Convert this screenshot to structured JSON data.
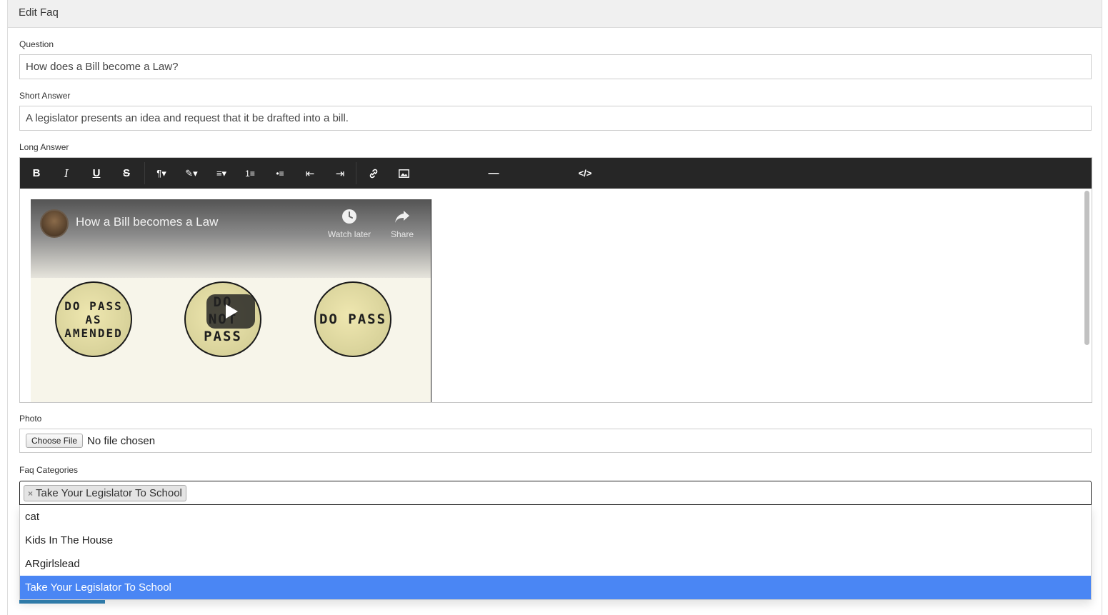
{
  "panel": {
    "title": "Edit Faq"
  },
  "question": {
    "label": "Question",
    "value": "How does a Bill become a Law?"
  },
  "short_answer": {
    "label": "Short Answer",
    "value": "A legislator presents an idea and request that it be drafted into a bill."
  },
  "long_answer": {
    "label": "Long Answer",
    "toolbar": [
      {
        "icon": "bold-icon",
        "glyph": "B"
      },
      {
        "icon": "italic-icon",
        "glyph": "I"
      },
      {
        "icon": "underline-icon",
        "glyph": "U"
      },
      {
        "icon": "strikethrough-icon",
        "glyph": "S"
      },
      {
        "icon": "paragraph-style-icon",
        "glyph": "¶▾"
      },
      {
        "icon": "magic-style-icon",
        "glyph": "✎▾"
      },
      {
        "icon": "align-icon",
        "glyph": "≡▾"
      },
      {
        "icon": "ordered-list-icon",
        "glyph": "1≡"
      },
      {
        "icon": "unordered-list-icon",
        "glyph": "•≡"
      },
      {
        "icon": "outdent-icon",
        "glyph": "⇤"
      },
      {
        "icon": "indent-icon",
        "glyph": "⇥"
      },
      {
        "icon": "link-icon",
        "glyph": "🔗"
      },
      {
        "icon": "image-icon",
        "glyph": "▣"
      },
      {
        "icon": "horizontal-rule-icon",
        "glyph": "—"
      },
      {
        "icon": "code-view-icon",
        "glyph": "</>"
      }
    ],
    "video": {
      "title": "How a Bill becomes a Law",
      "watch_later": "Watch later",
      "share": "Share",
      "stamps": [
        "DO PASS AS AMENDED",
        "DO NOT PASS",
        "DO PASS"
      ]
    }
  },
  "photo": {
    "label": "Photo",
    "button": "Choose File",
    "status": "No file chosen"
  },
  "categories": {
    "label": "Faq Categories",
    "selected": [
      "Take Your Legislator To School"
    ],
    "remove_glyph": "×",
    "options": [
      "cat",
      "Kids In The House",
      "ARgirlslead",
      "Take Your Legislator To School"
    ],
    "highlighted_index": 3,
    "highlight_color": "#4a86f4"
  }
}
